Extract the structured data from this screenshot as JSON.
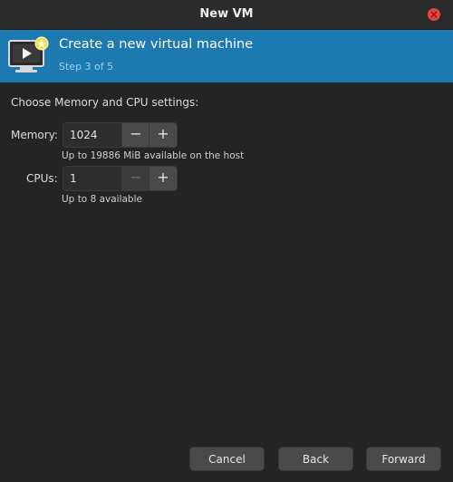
{
  "window": {
    "title": "New VM"
  },
  "header": {
    "title": "Create a new virtual machine",
    "step": "Step 3 of 5"
  },
  "section_label": "Choose Memory and CPU settings:",
  "memory": {
    "label": "Memory:",
    "value": "1024",
    "hint": "Up to 19886 MiB available on the host",
    "minus_label": "−",
    "plus_label": "+"
  },
  "cpus": {
    "label": "CPUs:",
    "value": "1",
    "hint": "Up to 8 available",
    "minus_label": "−",
    "plus_label": "+"
  },
  "buttons": {
    "cancel": "Cancel",
    "back": "Back",
    "forward": "Forward"
  },
  "icons": {
    "close": "close-icon",
    "vm": "virtual-machine-icon"
  },
  "colors": {
    "header_bg": "#1d7ab0",
    "close": "#e2453e",
    "window_bg": "#242424"
  }
}
